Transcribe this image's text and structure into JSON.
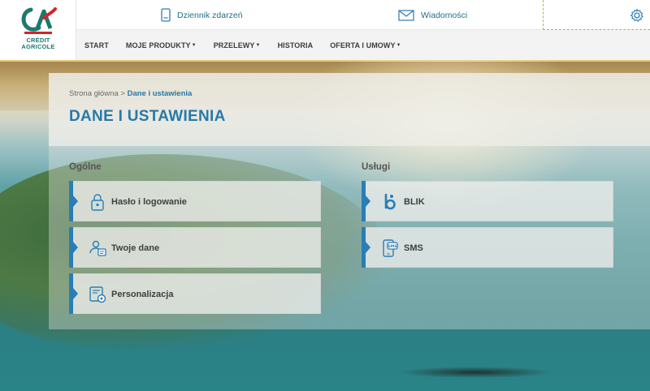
{
  "brand": {
    "name_line1": "CRÉDIT",
    "name_line2": "AGRICOLE"
  },
  "topbar": {
    "events_label": "Dziennik zdarzeń",
    "messages_label": "Wiadomości"
  },
  "nav": {
    "items": [
      {
        "label": "START",
        "dropdown": false
      },
      {
        "label": "MOJE PRODUKTY",
        "dropdown": true
      },
      {
        "label": "PRZELEWY",
        "dropdown": true
      },
      {
        "label": "HISTORIA",
        "dropdown": false
      },
      {
        "label": "OFERTA I UMOWY",
        "dropdown": true
      }
    ]
  },
  "breadcrumb": {
    "home": "Strona główna",
    "separator": ">",
    "current": "Dane i ustawienia"
  },
  "page_title": "DANE I USTAWIENIA",
  "sections": {
    "general": {
      "title": "Ogólne",
      "items": [
        {
          "label": "Hasło i logowanie",
          "icon": "lock-icon"
        },
        {
          "label": "Twoje dane",
          "icon": "user-card-icon"
        },
        {
          "label": "Personalizacja",
          "icon": "personalization-icon"
        }
      ]
    },
    "services": {
      "title": "Usługi",
      "items": [
        {
          "label": "BLIK",
          "icon": "blik-icon"
        },
        {
          "label": "SMS",
          "icon": "sms-phone-icon"
        }
      ]
    }
  },
  "colors": {
    "accent": "#2779a8",
    "card_flag": "#2a7db5",
    "brand_green": "#1b7a6e",
    "brand_red": "#d8222a"
  }
}
